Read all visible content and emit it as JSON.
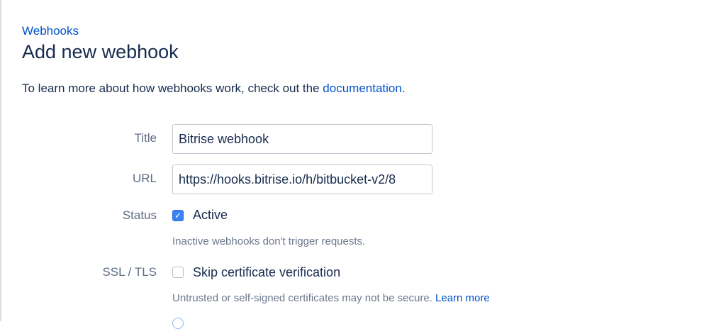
{
  "breadcrumb": "Webhooks",
  "page_title": "Add new webhook",
  "intro": {
    "text": "To learn more about how webhooks work, check out the ",
    "link": "documentation",
    "suffix": "."
  },
  "form": {
    "title": {
      "label": "Title",
      "value": "Bitrise webhook"
    },
    "url": {
      "label": "URL",
      "value": "https://hooks.bitrise.io/h/bitbucket-v2/8"
    },
    "status": {
      "label": "Status",
      "checkbox_label": "Active",
      "checked": true,
      "help": "Inactive webhooks don't trigger requests."
    },
    "ssl": {
      "label": "SSL / TLS",
      "checkbox_label": "Skip certificate verification",
      "checked": false,
      "help": "Untrusted or self-signed certificates may not be secure. ",
      "help_link": "Learn more"
    }
  },
  "colors": {
    "link": "#0052cc",
    "checkbox_checked": "#3b82f6"
  }
}
